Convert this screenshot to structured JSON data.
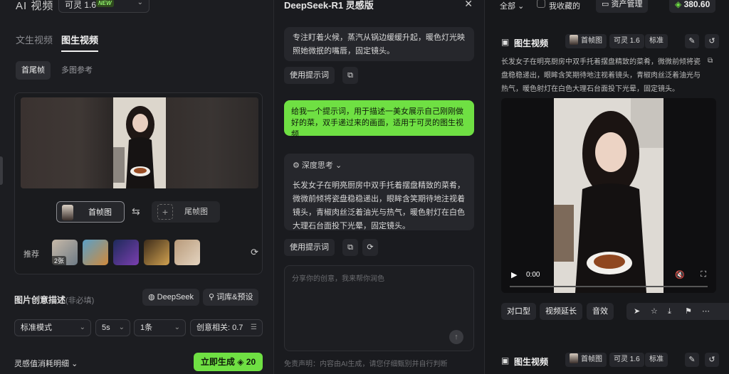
{
  "left": {
    "app_title": "AI 视频",
    "model_name": "可灵 1.6",
    "model_badge": "NEW",
    "tabs": [
      "文生视频",
      "图生视频"
    ],
    "sub_tabs": [
      "首尾帧",
      "多图参考"
    ],
    "first_frame_label": "首帧图",
    "last_frame_label": "尾帧图",
    "recommend_label": "推荐",
    "recommend_count": "2张",
    "desc_title": "图片创意描述",
    "desc_optional": "(非必填)",
    "deepseek_label": "DeepSeek",
    "library_label": "词库&预设",
    "mode": "标准模式",
    "duration": "5s",
    "quantity": "1条",
    "creativity": "创意相关: 0.7",
    "cost_detail": "灵感值消耗明细",
    "generate_label": "立即生成",
    "generate_cost": "20",
    "colors": {
      "accent": "#6fe043"
    }
  },
  "mid": {
    "title": "DeepSeek-R1 灵感版",
    "bubble1": "专注盯着火候，蒸汽从锅边缓缓升起，暖色灯光映照她微抿的嘴唇，固定镜头。",
    "use_prompt_label": "使用提示词",
    "user_msg": "给我一个提示词，用于描述一美女展示自己刚刚做好的菜，双手递过来的画面，适用于可灵的图生视频",
    "think_label": "深度思考",
    "think_text": "长发女子在明亮厨房中双手托着摆盘精致的菜肴，微微前倾将瓷盘稳稳递出，眼眸含笑期待地注视着镜头，青椒肉丝泛着油光与热气，暖色射灯在白色大理石台面投下光晕，固定镜头。",
    "input_placeholder": "分享你的创意，我来帮你润色",
    "disclaimer": "免责声明：内容由AI生成，请您仔细甄别并自行判断"
  },
  "right": {
    "filter_all": "全部",
    "favorites": "我收藏的",
    "asset_label": "资产管理",
    "balance": "380.60",
    "card_title": "图生视频",
    "chip_first": "首帧图",
    "chip_model": "可灵 1.6",
    "chip_quality": "标准",
    "description": "长发女子在明亮厨房中双手托着摆盘精致的菜肴，微微前倾将瓷盘稳稳递出，眼眸含笑期待地注视着镜头，青椒肉丝泛着油光与热气，暖色射灯在白色大理石台面投下光晕，固定镜头。",
    "video_time": "0:00",
    "actions": [
      "对口型",
      "视频延长",
      "音效"
    ]
  }
}
